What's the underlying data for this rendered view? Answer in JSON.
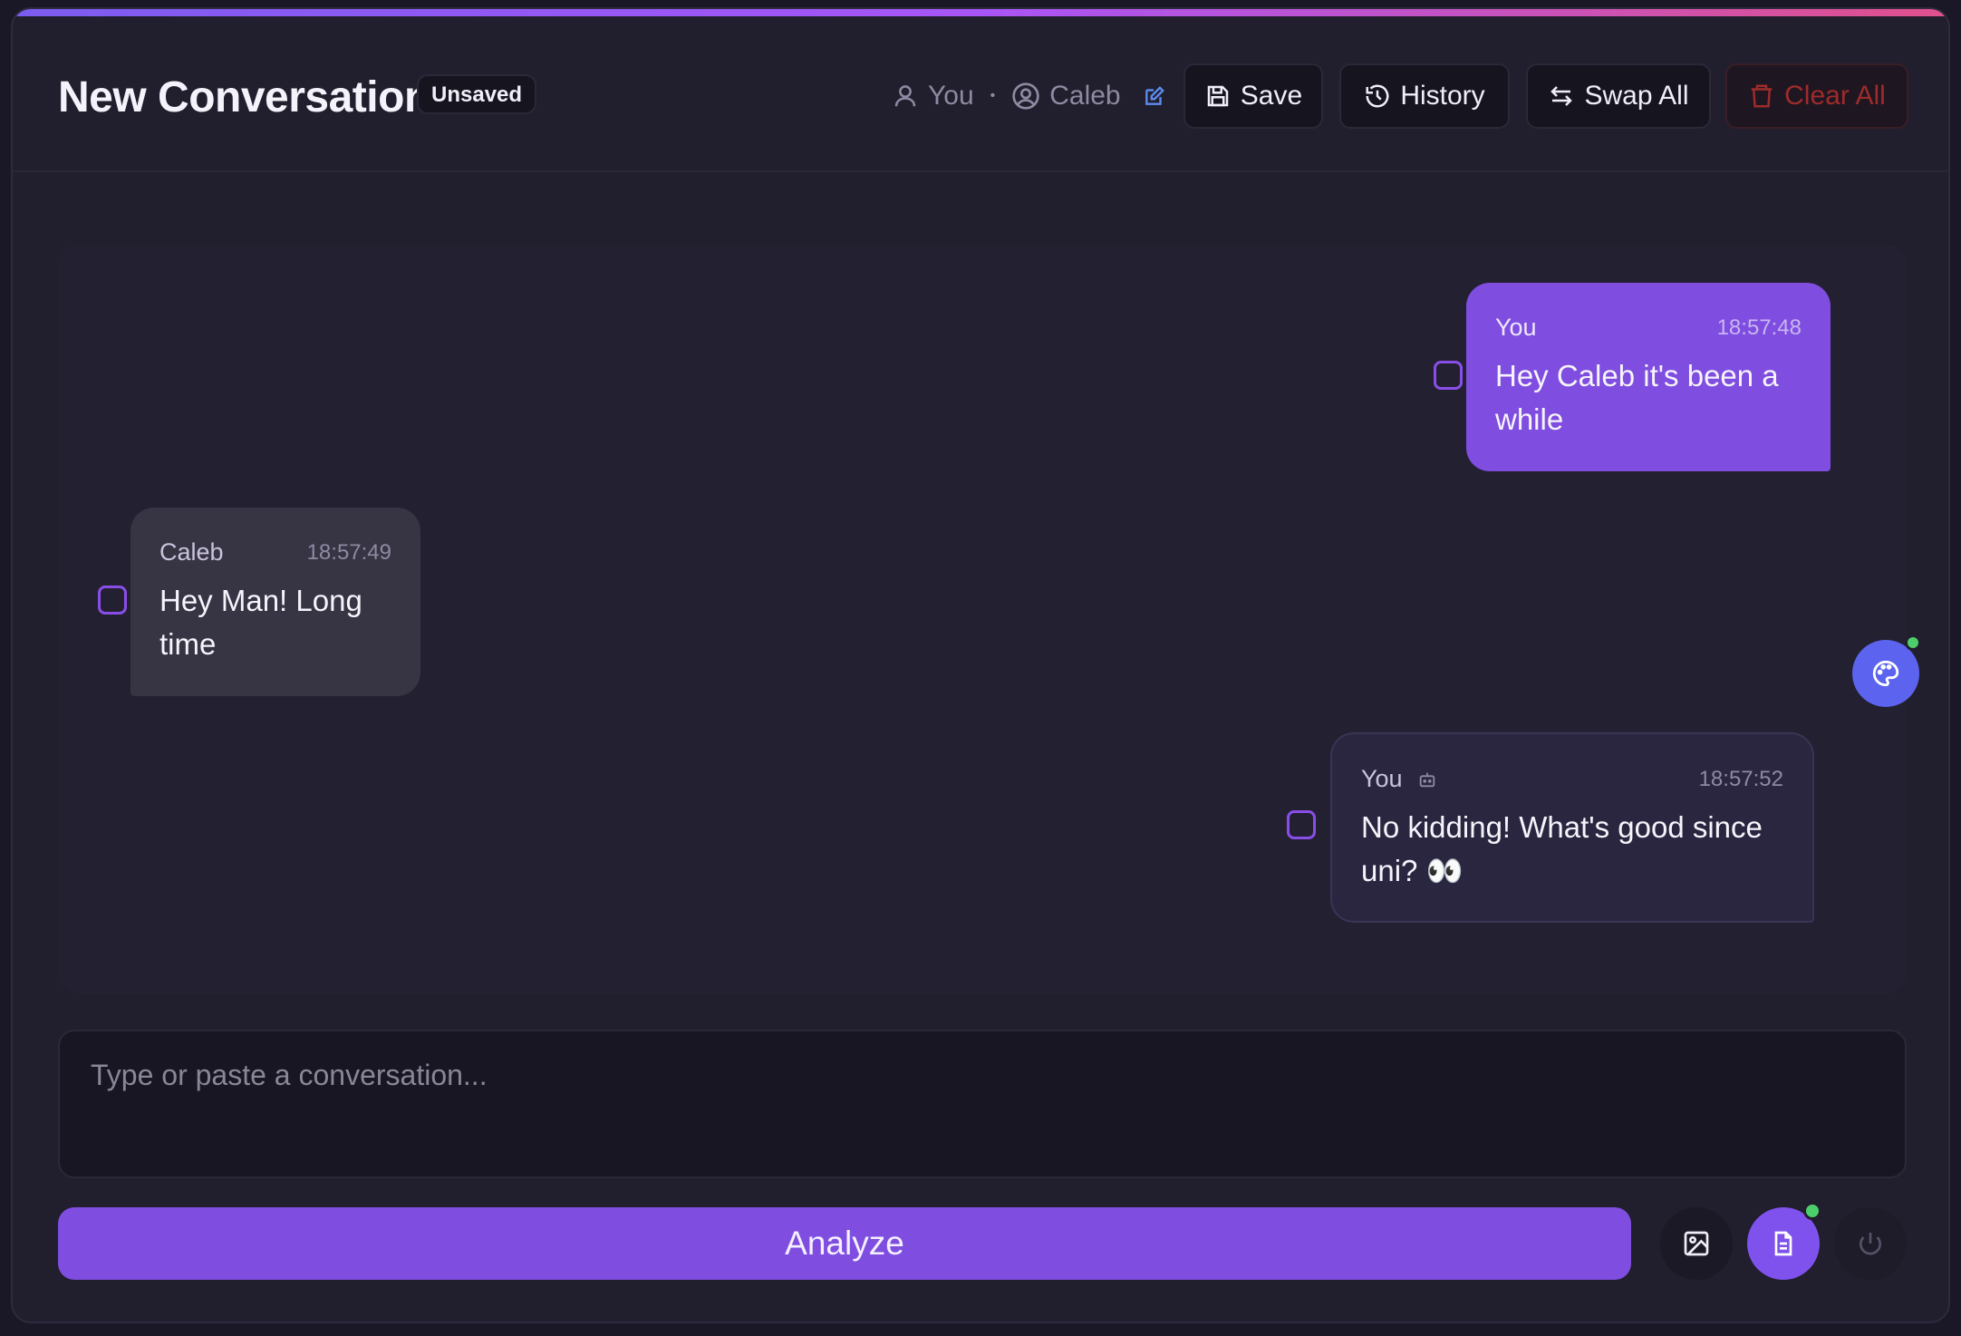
{
  "header": {
    "title": "New Conversation",
    "status_badge": "Unsaved",
    "participants": {
      "self": "You",
      "other": "Caleb",
      "separator": "•"
    },
    "buttons": {
      "save": "Save",
      "history": "History",
      "swap_all": "Swap All",
      "clear_all": "Clear All"
    }
  },
  "messages": [
    {
      "sender": "You",
      "time": "18:57:48",
      "text": "Hey Caleb it's been a while",
      "side": "right",
      "style": "primary"
    },
    {
      "sender": "Caleb",
      "time": "18:57:49",
      "text": "Hey Man! Long time",
      "side": "left",
      "style": "neutral"
    },
    {
      "sender": "You",
      "time": "18:57:52",
      "text": "No kidding! What's good since uni? 👀",
      "side": "right",
      "style": "outlined",
      "icon": "bot-icon"
    }
  ],
  "composer": {
    "placeholder": "Type or paste a conversation...",
    "value": ""
  },
  "actions": {
    "analyze": "Analyze"
  },
  "colors": {
    "accent": "#7f4de0",
    "danger": "#9e2b2b",
    "online": "#4ccf6a",
    "palette_button": "#5b63ef"
  },
  "icons": {
    "palette": "palette-icon",
    "image": "image-icon",
    "document": "document-icon",
    "power": "power-icon"
  }
}
